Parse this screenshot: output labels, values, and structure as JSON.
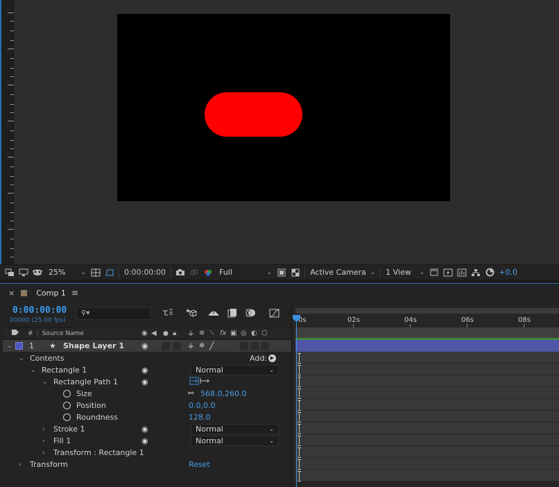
{
  "viewer": {
    "zoom": "25%",
    "timecode": "0:00:00:00",
    "resolution": "Full",
    "camera": "Active Camera",
    "views": "1 View",
    "exposure": "+0.0",
    "shape_color": "#ff0000"
  },
  "timeline": {
    "comp_name": "Comp 1",
    "current_time": "0:00:00:00",
    "frame_info": "00000 (25.00 fps)",
    "search_placeholder": "",
    "columns": {
      "number": "#",
      "source_name": "Source Name"
    },
    "layer": {
      "number": "1",
      "name": "Shape Layer 1"
    },
    "rows": {
      "contents": "Contents",
      "add_label": "Add:",
      "rectangle": "Rectangle 1",
      "rectangle_mode": "Normal",
      "rectangle_path": "Rectangle Path 1",
      "size_label": "Size",
      "size_value": "568.0,260.0",
      "position_label": "Position",
      "position_value": "0.0,0.0",
      "roundness_label": "Roundness",
      "roundness_value": "128.0",
      "stroke": "Stroke 1",
      "stroke_mode": "Normal",
      "fill": "Fill 1",
      "fill_mode": "Normal",
      "transform_rect": "Transform : Rectangle 1",
      "transform": "Transform",
      "reset": "Reset"
    },
    "ruler_labels": [
      "0s",
      "02s",
      "04s",
      "06s",
      "08s"
    ]
  }
}
